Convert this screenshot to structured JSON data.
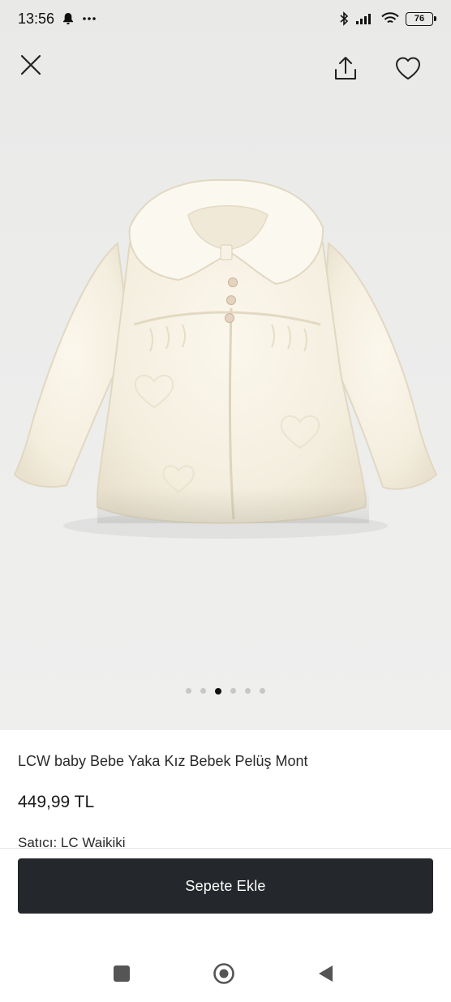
{
  "status_bar": {
    "time": "13:56",
    "battery": "76",
    "icons": [
      "notification-bell-icon",
      "more-dots-icon",
      "bluetooth-icon",
      "signal-icon",
      "wifi-icon",
      "battery-icon"
    ]
  },
  "top_bar": {
    "icons": [
      "close-icon",
      "share-icon",
      "heart-icon"
    ]
  },
  "gallery": {
    "image_count": 6,
    "active_index": 2
  },
  "product": {
    "title": "LCW baby Bebe Yaka Kız Bebek Pelüş Mont",
    "price": "449,99 TL",
    "seller_label": "Satıcı:",
    "seller_name": "LC Waikiki"
  },
  "cart_button": {
    "label": "Sepete Ekle",
    "color": "#24272b"
  },
  "nav_bar": {
    "icons": [
      "recent-apps-icon",
      "home-icon",
      "back-icon"
    ]
  }
}
